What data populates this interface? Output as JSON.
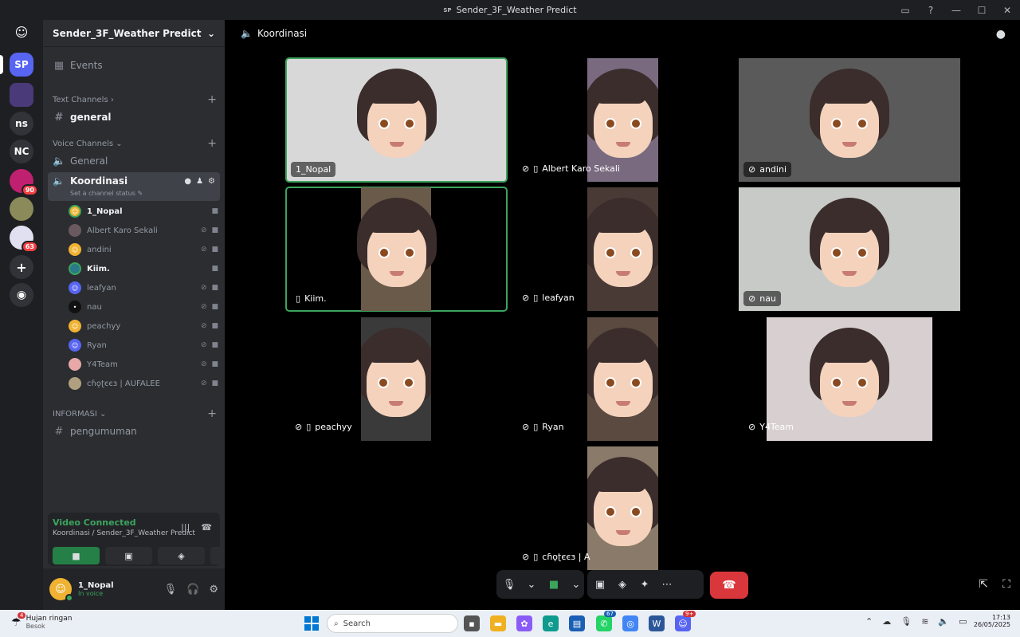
{
  "window": {
    "title": "Sender_3F_Weather Predict",
    "icon_label": "SP"
  },
  "guilds": [
    {
      "label": "SP",
      "color": "#5865f2"
    },
    {
      "label": "ns",
      "color": "#2b2d31"
    },
    {
      "label": "NC",
      "color": "#2b2d31"
    },
    {
      "badge": "90"
    },
    {
      "badge": "63"
    }
  ],
  "sidebar": {
    "server_name": "Sender_3F_Weather Predict",
    "events_label": "Events",
    "text_category": "Text Channels",
    "text_channel": "general",
    "voice_category": "Voice Channels",
    "voice_general": "General",
    "active_voice": "Koordinasi",
    "channel_status": "Set a channel status",
    "members": [
      "1_Nopal",
      "Albert Karo Sekali",
      "andini",
      "Kiim.",
      "leafyan",
      "nau",
      "peachyy",
      "Ryan",
      "Y4Team",
      "ᴄɦǫʈєєɜ | AUFALEE"
    ],
    "info_category": "INFORMASI",
    "info_channel": "pengumuman"
  },
  "voice_panel": {
    "status": "Video Connected",
    "location": "Koordinasi / Sender_3F_Weather Predict"
  },
  "user": {
    "name": "1_Nopal",
    "status": "In voice"
  },
  "main": {
    "channel": "Koordinasi"
  },
  "tiles": [
    "1_Nopal",
    "Albert Karo Sekali",
    "andini",
    "Kiim.",
    "leafyan",
    "nau",
    "peachyy",
    "Ryan",
    "Y4Team",
    "ᴄɦǫʈєєɜ | A"
  ],
  "taskbar": {
    "weather_title": "Hujan ringan",
    "weather_sub": "Besok",
    "weather_badge": "4",
    "search_placeholder": "Search",
    "time": "17:13",
    "date": "26/05/2025",
    "whatsapp_badge": "67",
    "discord_badge": "9+"
  }
}
